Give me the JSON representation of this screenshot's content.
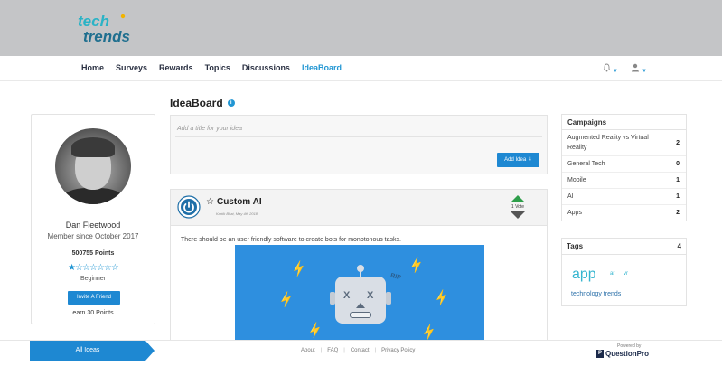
{
  "brand": {
    "logo_text_1": "tech",
    "logo_text_2": "trends",
    "accent": "#2196d3"
  },
  "nav": {
    "items": [
      {
        "label": "Home"
      },
      {
        "label": "Surveys"
      },
      {
        "label": "Rewards"
      },
      {
        "label": "Topics"
      },
      {
        "label": "Discussions"
      },
      {
        "label": "IdeaBoard",
        "active": true
      }
    ],
    "icons": [
      "bell-icon",
      "user-icon"
    ]
  },
  "page": {
    "title": "IdeaBoard",
    "info_glyph": "i"
  },
  "profile": {
    "name": "Dan Fleetwood",
    "member_since": "Member since October 2017",
    "points": "500755 Points",
    "stars_filled": 1,
    "stars_total": 7,
    "stars_display": "★☆☆☆☆☆☆",
    "level": "Beginner",
    "invite_label": "Invite A Friend",
    "earn_text": "earn 30 Points"
  },
  "idea_form": {
    "placeholder": "Add a title for your idea",
    "add_button_label": "Add Idea ⇩"
  },
  "idea": {
    "title": "Custom AI",
    "star_glyph": "☆",
    "author_meta": "Kartik Bhat, May 4th 2018",
    "votes": "1 Vote",
    "body": "There should be an user friendly software to create bots for monotonous tasks.",
    "image_text": "RIP",
    "eye_glyph": "X"
  },
  "campaigns": {
    "title": "Campaigns",
    "items": [
      {
        "name": "Augmented Reality vs Virtual Reality",
        "count": "2"
      },
      {
        "name": "General Tech",
        "count": "0"
      },
      {
        "name": "Mobile",
        "count": "1"
      },
      {
        "name": "AI",
        "count": "1"
      },
      {
        "name": "Apps",
        "count": "2"
      }
    ]
  },
  "tags": {
    "title": "Tags",
    "count": "4",
    "items": [
      "app",
      "ar",
      "vr",
      "technology trends"
    ]
  },
  "footer": {
    "all_ideas_label": "All Ideas",
    "links": [
      "About",
      "FAQ",
      "Contact",
      "Privacy Policy"
    ],
    "separator": "|",
    "powered_by": "Powered by",
    "provider": "QuestionPro",
    "provider_mark": "P"
  }
}
